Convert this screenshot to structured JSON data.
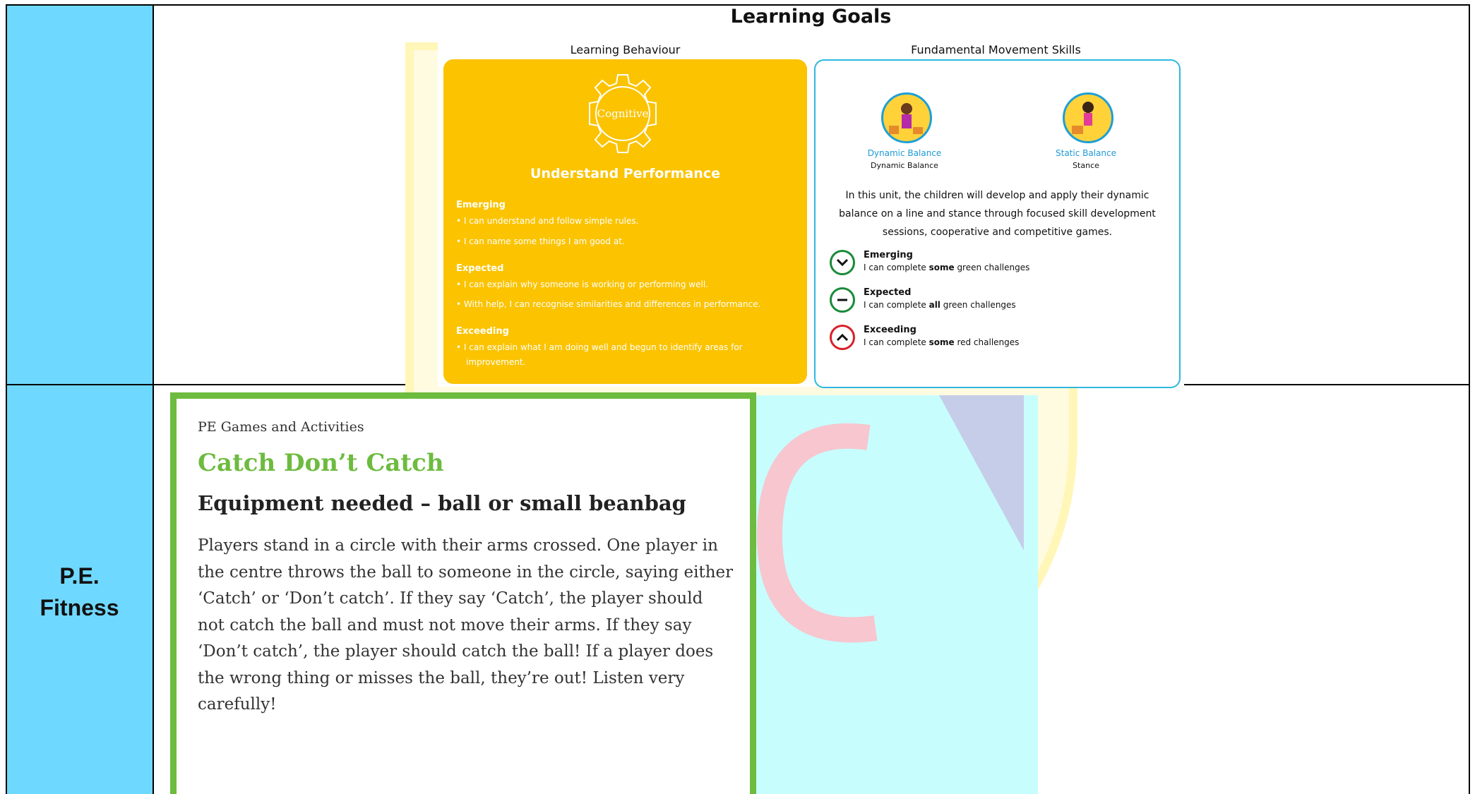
{
  "subject": {
    "line1": "P.E.",
    "line2": "Fitness"
  },
  "learning_goals": {
    "title": "Learning Goals",
    "behaviour_header": "Learning Behaviour",
    "fms_header": "Fundamental Movement Skills",
    "behaviour_card": {
      "gear_label": "Cognitive",
      "title": "Understand Performance",
      "sections": [
        {
          "heading": "Emerging",
          "items": [
            "I can understand and follow simple rules.",
            "I can name some things I am good at."
          ]
        },
        {
          "heading": "Expected",
          "items": [
            "I can explain why someone is working or performing well.",
            "With help, I can recognise similarities and differences in performance."
          ]
        },
        {
          "heading": "Exceeding",
          "items": [
            "I can explain what I am doing well and begun to identify areas for",
            "improvement."
          ]
        }
      ]
    },
    "fms_card": {
      "skills": [
        {
          "label": "Dynamic Balance",
          "sub": "Dynamic Balance"
        },
        {
          "label": "Static Balance",
          "sub": "Stance"
        }
      ],
      "description": "In this unit, the children will develop and apply their dynamic balance on a line and stance through focused skill development sessions, cooperative and competitive games.",
      "levels": [
        {
          "heading": "Emerging",
          "text_pre": "I can complete ",
          "text_bold": "some",
          "text_post": " green challenges",
          "color": "#1a8a3a",
          "symbol": "⌄"
        },
        {
          "heading": "Expected",
          "text_pre": "I can complete ",
          "text_bold": "all",
          "text_post": " green challenges",
          "color": "#1a8a3a",
          "symbol": "–"
        },
        {
          "heading": "Exceeding",
          "text_pre": "I can complete ",
          "text_bold": "some",
          "text_post": " red challenges",
          "color": "#d8202a",
          "symbol": "⌃"
        }
      ]
    }
  },
  "pe_activity": {
    "category": "PE Games and Activities",
    "title": "Catch Don’t Catch",
    "equipment": "Equipment needed – ball or small beanbag",
    "body": "Players stand in a circle with their arms crossed. One player in the centre throws the ball to someone in the circle, saying either ‘Catch’ or ‘Don’t catch’. If they say ‘Catch’, the player should not catch the ball and must not move their arms. If they say ‘Don’t catch’, the player should catch the ball! If a player does the wrong thing or misses the ball, they’re out! Listen very carefully!"
  },
  "colors": {
    "subject_cell": "#6fd8ff",
    "yellow": "#fbc300",
    "green": "#6dbb3f",
    "blue": "#2fb8e0"
  }
}
